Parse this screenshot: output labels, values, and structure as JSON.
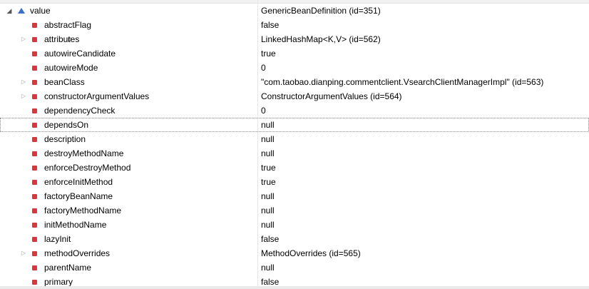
{
  "root": {
    "name": "value",
    "value": "GenericBeanDefinition  (id=351)",
    "icon": "object-instance-icon",
    "expanded": true
  },
  "fields": [
    {
      "name": "abstractFlag",
      "value": "false",
      "expandable": false,
      "final": false,
      "icon": "field-icon"
    },
    {
      "name": "attributes",
      "value": "LinkedHashMap<K,V>  (id=562)",
      "expandable": true,
      "final": true,
      "icon": "field-icon"
    },
    {
      "name": "autowireCandidate",
      "value": "true",
      "expandable": false,
      "final": false,
      "icon": "field-icon"
    },
    {
      "name": "autowireMode",
      "value": "0",
      "expandable": false,
      "final": false,
      "icon": "field-icon"
    },
    {
      "name": "beanClass",
      "value": "\"com.taobao.dianping.commentclient.VsearchClientManagerImpl\" (id=563)",
      "expandable": true,
      "final": false,
      "icon": "field-icon"
    },
    {
      "name": "constructorArgumentValues",
      "value": "ConstructorArgumentValues  (id=564)",
      "expandable": true,
      "final": false,
      "icon": "field-icon"
    },
    {
      "name": "dependencyCheck",
      "value": "0",
      "expandable": false,
      "final": false,
      "icon": "field-icon"
    },
    {
      "name": "dependsOn",
      "value": "null",
      "expandable": false,
      "final": false,
      "icon": "field-icon",
      "selected": true
    },
    {
      "name": "description",
      "value": "null",
      "expandable": false,
      "final": false,
      "icon": "field-icon"
    },
    {
      "name": "destroyMethodName",
      "value": "null",
      "expandable": false,
      "final": false,
      "icon": "field-icon"
    },
    {
      "name": "enforceDestroyMethod",
      "value": "true",
      "expandable": false,
      "final": false,
      "icon": "field-icon"
    },
    {
      "name": "enforceInitMethod",
      "value": "true",
      "expandable": false,
      "final": false,
      "icon": "field-icon"
    },
    {
      "name": "factoryBeanName",
      "value": "null",
      "expandable": false,
      "final": false,
      "icon": "field-icon"
    },
    {
      "name": "factoryMethodName",
      "value": "null",
      "expandable": false,
      "final": false,
      "icon": "field-icon"
    },
    {
      "name": "initMethodName",
      "value": "null",
      "expandable": false,
      "final": false,
      "icon": "field-icon"
    },
    {
      "name": "lazyInit",
      "value": "false",
      "expandable": false,
      "final": false,
      "icon": "field-icon"
    },
    {
      "name": "methodOverrides",
      "value": "MethodOverrides  (id=565)",
      "expandable": true,
      "final": false,
      "icon": "field-icon"
    },
    {
      "name": "parentName",
      "value": "null",
      "expandable": false,
      "final": false,
      "icon": "field-icon"
    },
    {
      "name": "primary",
      "value": "false",
      "expandable": false,
      "final": false,
      "icon": "field-icon"
    }
  ],
  "glyphs": {
    "expanded": "◢",
    "collapsed": "▷",
    "final": "F"
  },
  "colors": {
    "field_icon": "#d9363e",
    "object_icon": "#3b6fc9"
  }
}
